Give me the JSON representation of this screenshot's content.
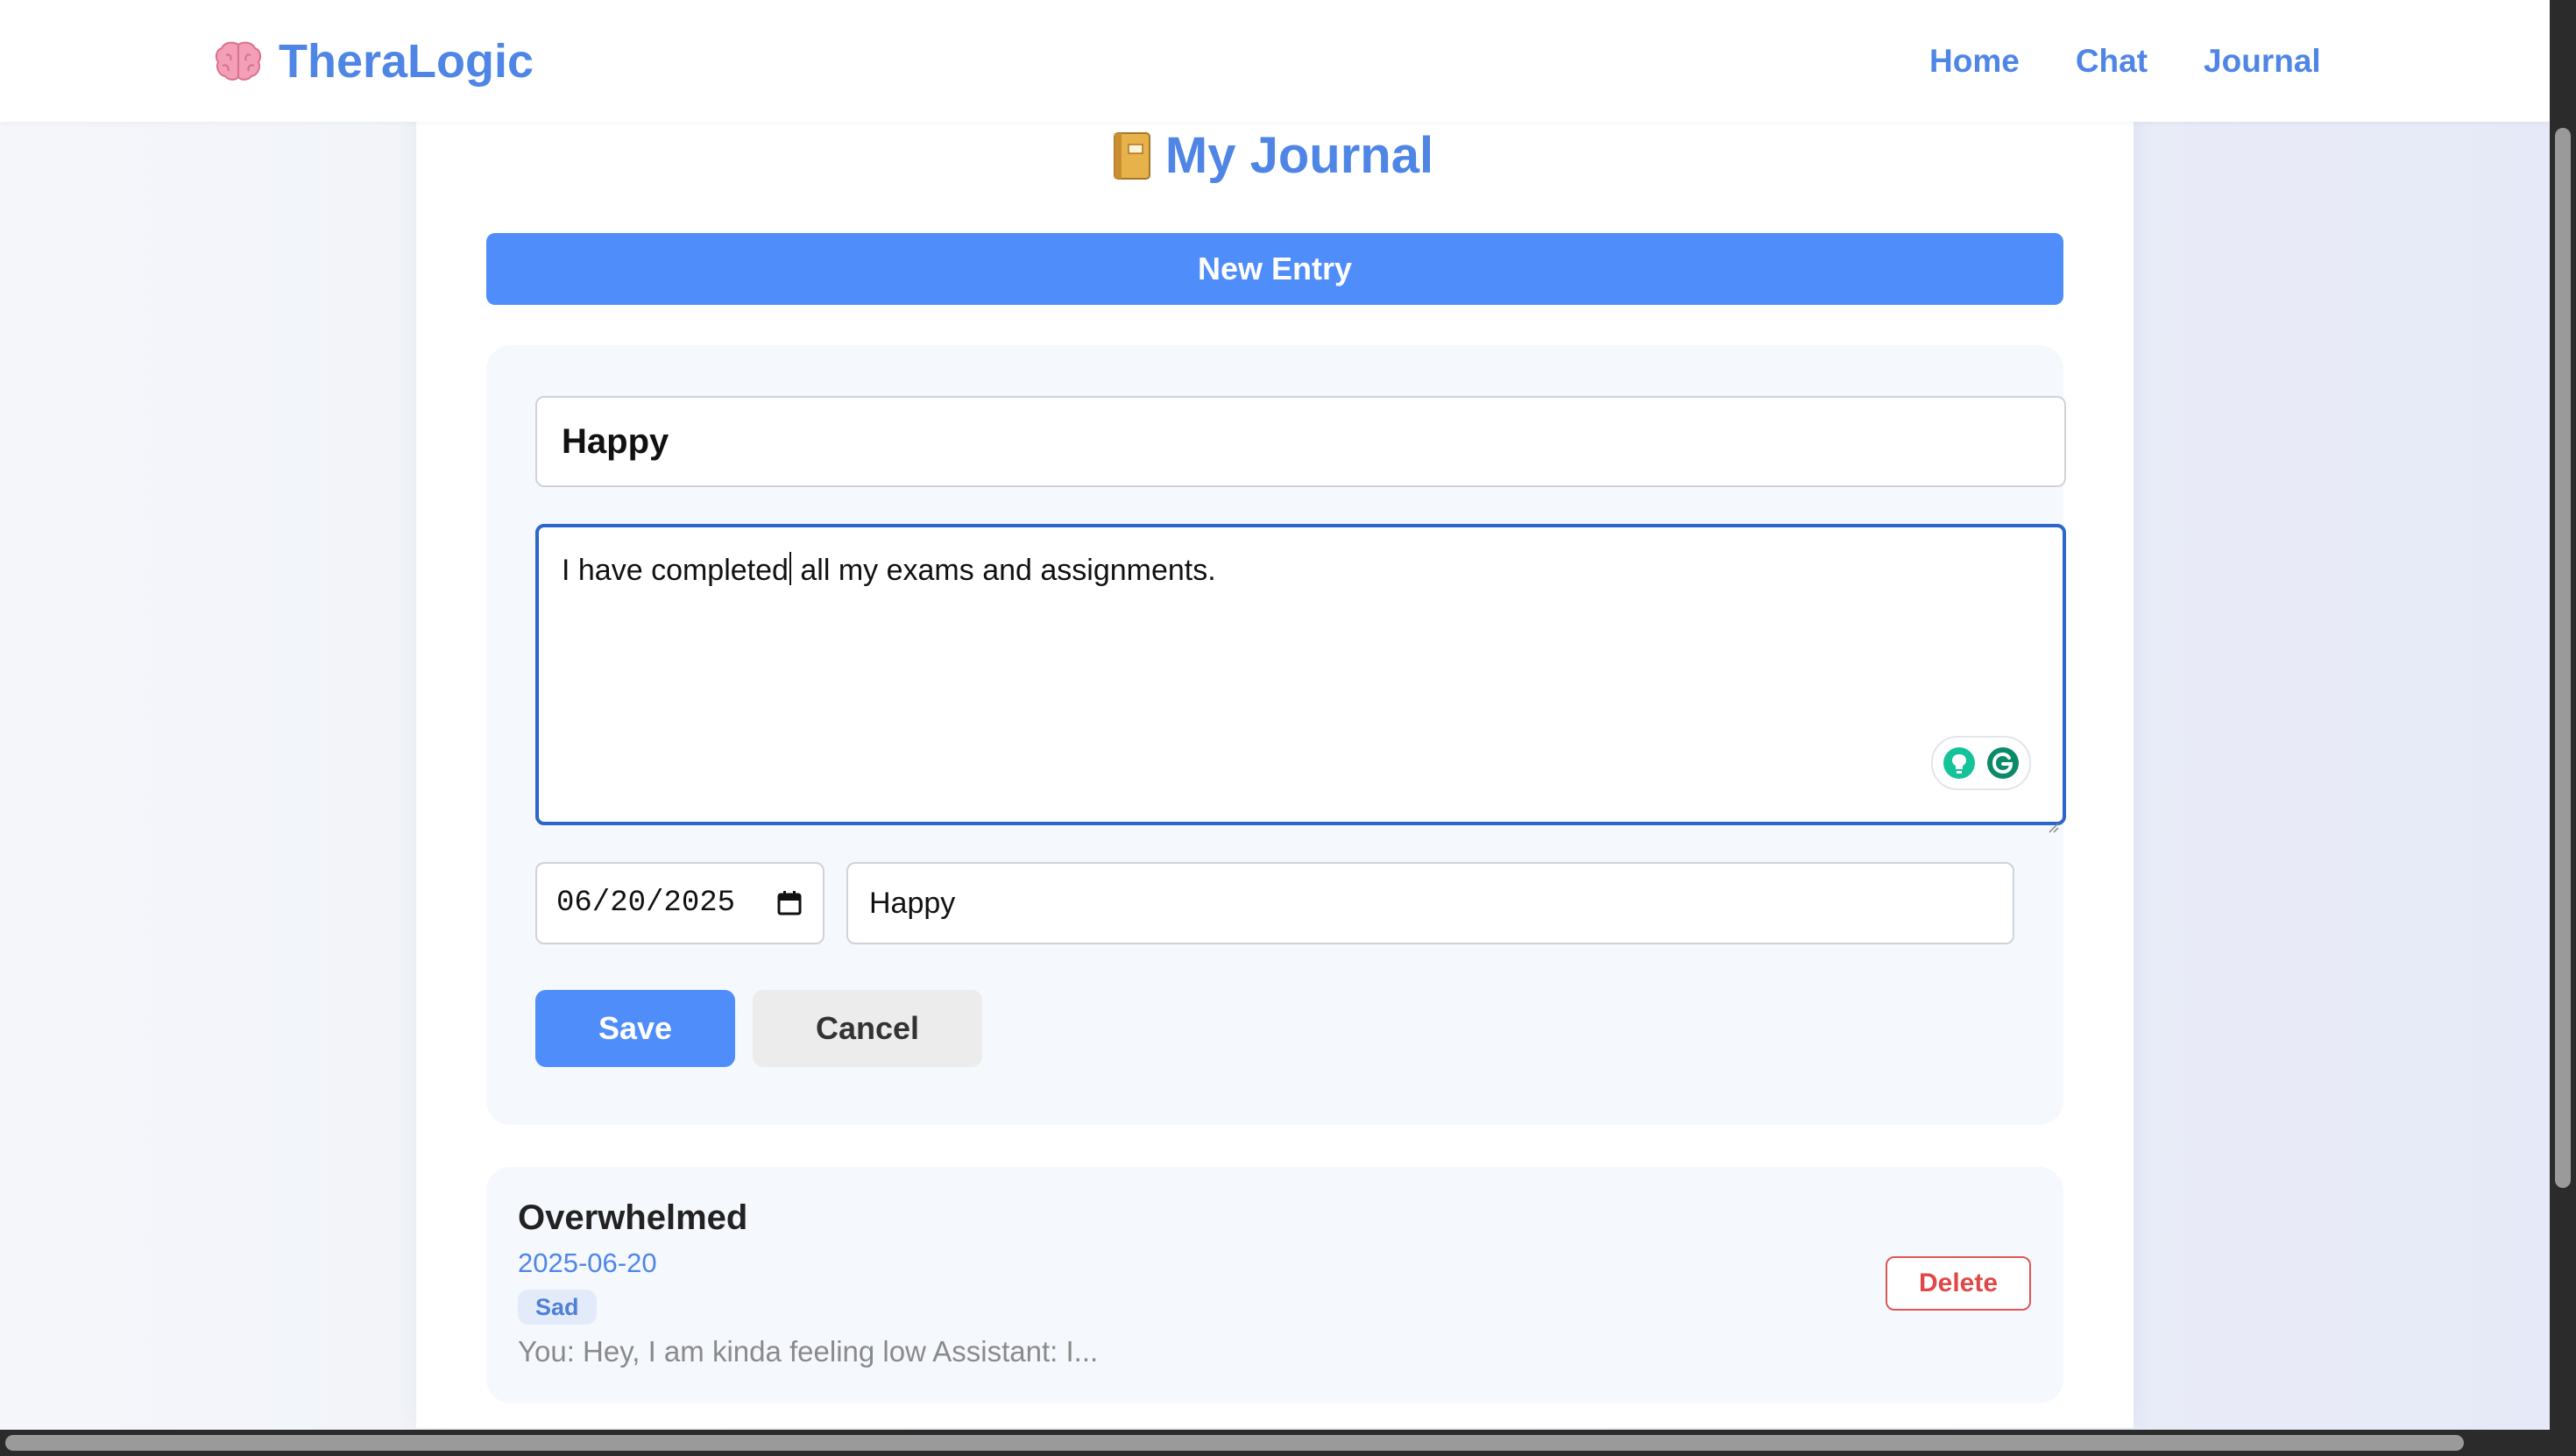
{
  "app": {
    "name": "TheraLogic",
    "brand_icon": "brain-icon"
  },
  "nav": {
    "links": [
      "Home",
      "Chat",
      "Journal"
    ]
  },
  "page": {
    "title": "My Journal",
    "title_icon": "notebook-icon"
  },
  "toolbar": {
    "new_entry_label": "New Entry"
  },
  "form": {
    "title_value": "Happy",
    "content_before_caret": "I have completed",
    "content_after_caret": " all my exams and assignments.",
    "date_value": "06/20/2025",
    "mood_value": "Happy",
    "save_label": "Save",
    "cancel_label": "Cancel"
  },
  "entries": [
    {
      "title": "Overwhelmed",
      "date": "2025-06-20",
      "mood": "Sad",
      "preview": "You: Hey, I am kinda feeling low Assistant: I...",
      "delete_label": "Delete"
    }
  ],
  "colors": {
    "brand": "#4f86e6",
    "primary_button": "#4f8dfb",
    "focus_border": "#2a66cc",
    "delete_red": "#e04848",
    "card_bg": "#f5f8fd"
  }
}
